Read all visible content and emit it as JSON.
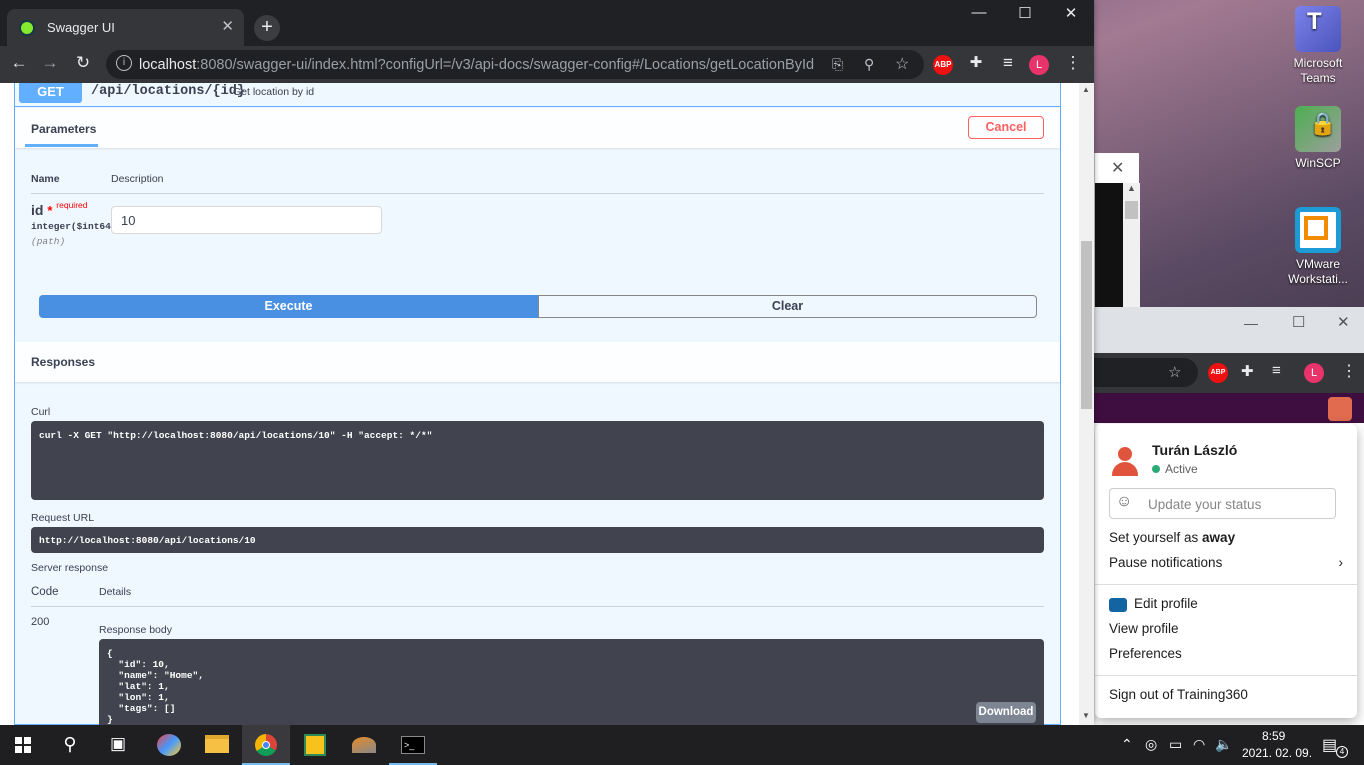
{
  "browser": {
    "tab_title": "Swagger UI",
    "url_host": "localhost",
    "url_rest": ":8080/swagger-ui/index.html?configUrl=/v3/api-docs/swagger-config#/Locations/getLocationById",
    "profile_initial": "L",
    "adblock_label": "ABP"
  },
  "operation": {
    "method": "GET",
    "path": "/api/locations/{id}",
    "summary": "Get location by id"
  },
  "parameters": {
    "section_title": "Parameters",
    "cancel_label": "Cancel",
    "col_name": "Name",
    "col_description": "Description",
    "param_name": "id",
    "required_star": "*",
    "required_label": "required",
    "param_type": "integer($int64)",
    "param_location": "(path)",
    "param_value": "10",
    "execute_label": "Execute",
    "clear_label": "Clear"
  },
  "responses": {
    "section_title": "Responses",
    "curl_label": "Curl",
    "curl_command": "curl -X GET \"http://localhost:8080/api/locations/10\" -H \"accept: */*\"",
    "request_url_label": "Request URL",
    "request_url": "http://localhost:8080/api/locations/10",
    "server_response_label": "Server response",
    "col_code": "Code",
    "col_details": "Details",
    "code": "200",
    "response_body_label": "Response body",
    "response_body": "{\n  \"id\": 10,\n  \"name\": \"Home\",\n  \"lat\": 1,\n  \"lon\": 1,\n  \"tags\": []\n}",
    "download_label": "Download"
  },
  "desktop_icons": [
    {
      "label": "Microsoft Teams",
      "icon": "teams-icon"
    },
    {
      "label": "WinSCP",
      "icon": "winscp-icon"
    },
    {
      "label": "VMware Workstati...",
      "icon": "vmware-icon"
    }
  ],
  "slack_menu": {
    "user_name": "Turán László",
    "status": "Active",
    "status_placeholder": "Update your status",
    "set_away_prefix": "Set yourself as ",
    "set_away_bold": "away",
    "pause_notifications": "Pause notifications",
    "edit_profile": "Edit profile",
    "view_profile": "View profile",
    "preferences": "Preferences",
    "sign_out": "Sign out of Training360"
  },
  "taskbar": {
    "time": "8:59",
    "date": "2021. 02. 09.",
    "notification_count": "4"
  },
  "colors": {
    "get_blue": "#61affe",
    "execute_blue": "#4990e2",
    "cancel_red": "#ff6060",
    "code_bg": "#41444e",
    "slack_purple": "#3f0e40",
    "active_green": "#2bac76"
  }
}
